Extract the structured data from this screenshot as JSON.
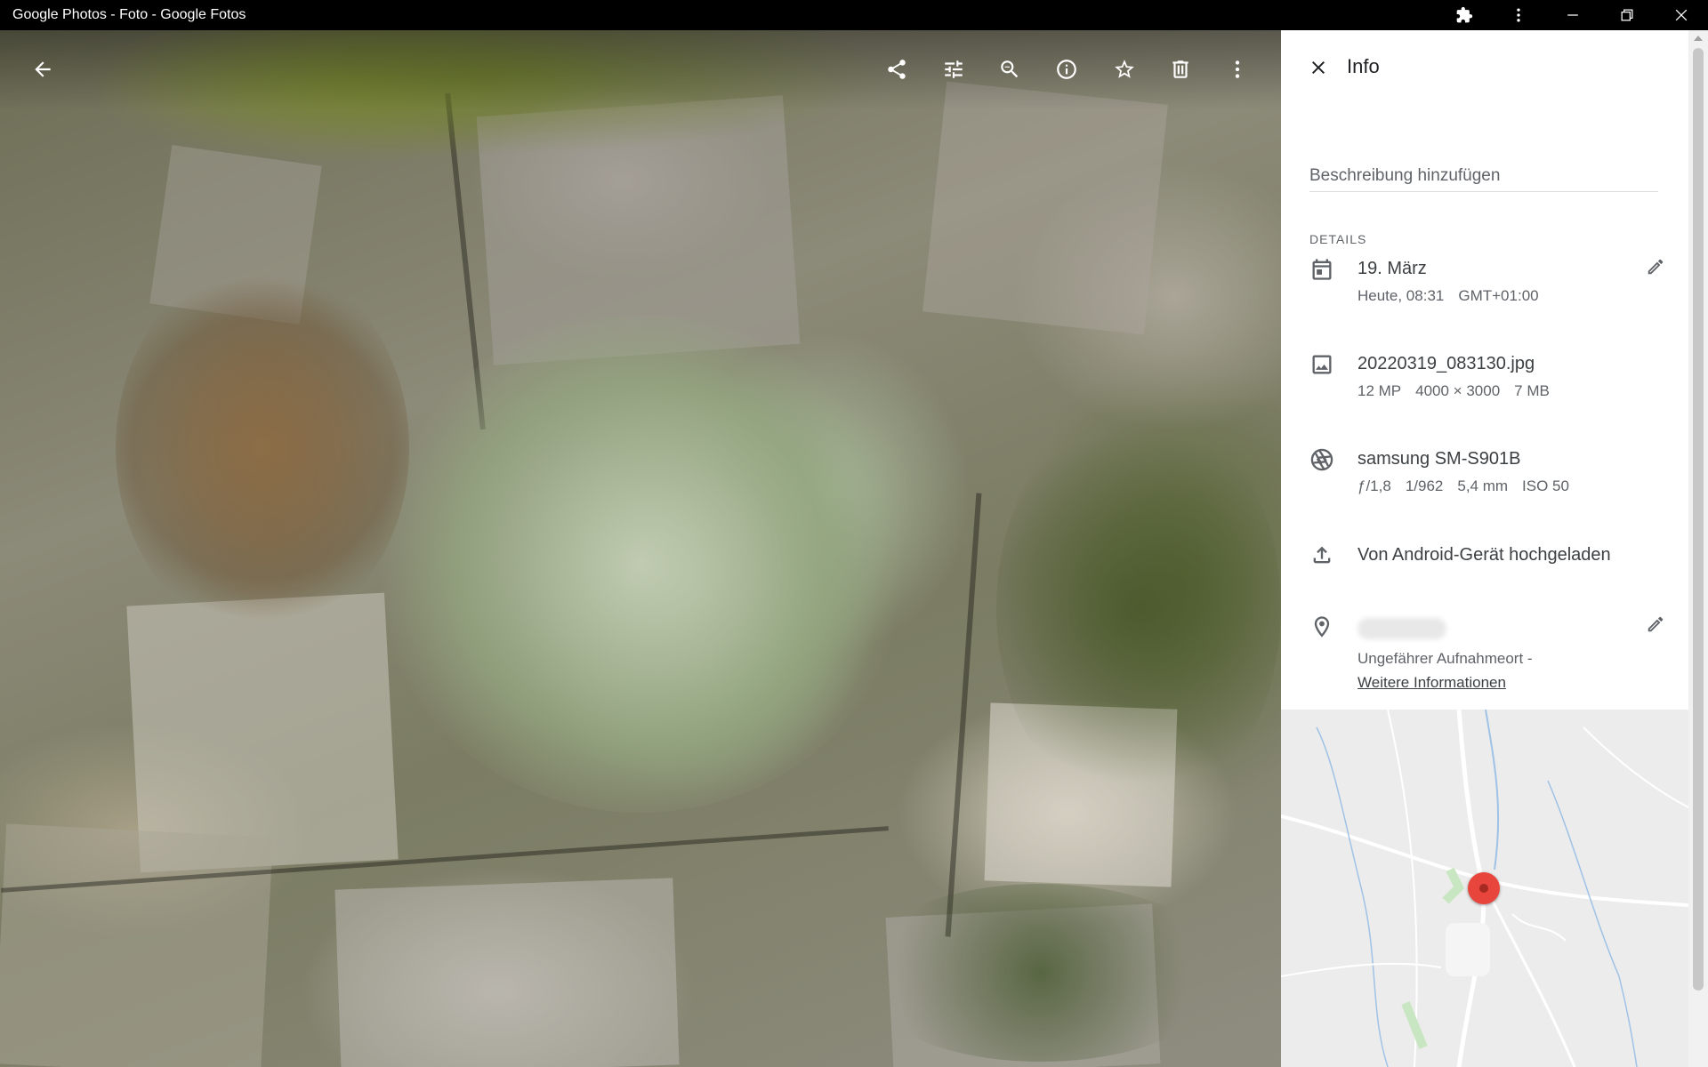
{
  "window": {
    "title": "Google Photos - Foto - Google Fotos"
  },
  "viewer": {
    "toolbar_icons": [
      "arrow-back-icon",
      "share-icon",
      "edit-tune-icon",
      "zoom-icon",
      "info-icon",
      "star-icon",
      "delete-icon",
      "more-vert-icon"
    ]
  },
  "panel": {
    "title": "Info",
    "description_placeholder": "Beschreibung hinzufügen",
    "details_label": "DETAILS",
    "date": {
      "main": "19. März",
      "sub": [
        "Heute, 08:31",
        "GMT+01:00"
      ]
    },
    "file": {
      "main": "20220319_083130.jpg",
      "sub": [
        "12 MP",
        "4000 × 3000",
        "7 MB"
      ]
    },
    "camera": {
      "main": "samsung SM-S901B",
      "sub": [
        "ƒ/1,8",
        "1/962",
        "5,4 mm",
        "ISO 50"
      ]
    },
    "upload": {
      "main": "Von Android-Gerät hochgeladen"
    },
    "location": {
      "note": "Ungefährer Aufnahmeort -",
      "link": "Weitere Informationen"
    }
  },
  "colors": {
    "map_pin": "#e8453c",
    "panel_bg": "#ffffff",
    "text_primary": "#3c4043",
    "text_secondary": "#5f6368"
  }
}
